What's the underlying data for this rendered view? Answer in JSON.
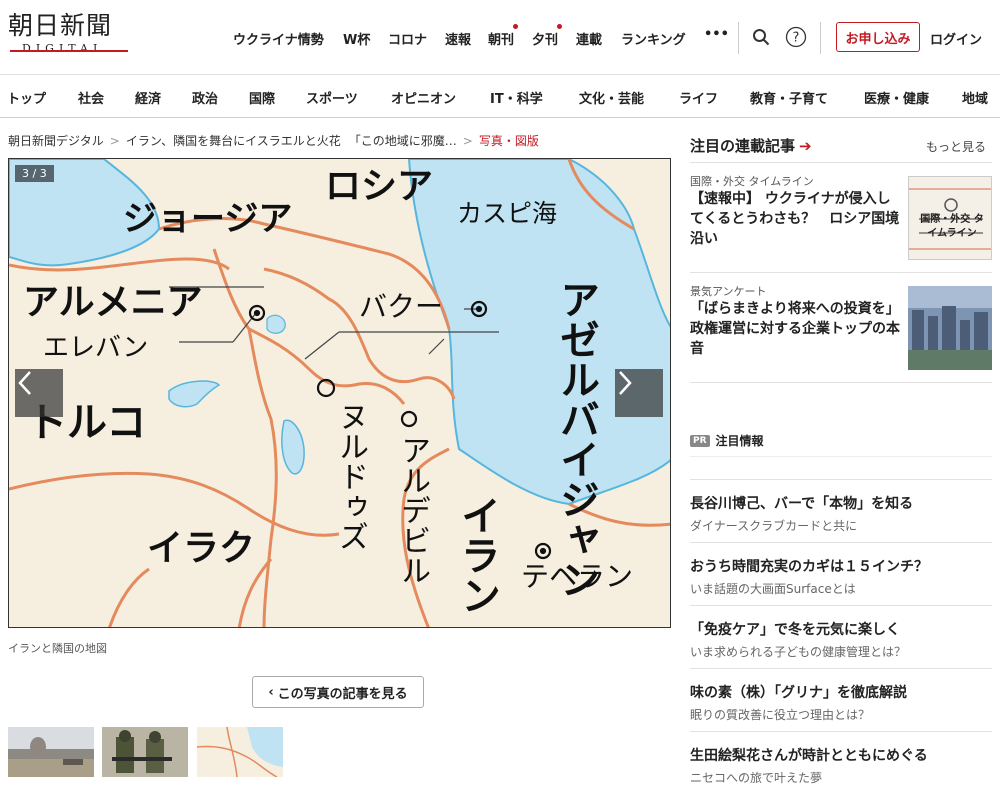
{
  "header": {
    "logo_ja": "朝日新聞",
    "logo_en": "DIGITAL",
    "nav": [
      "ウクライナ情勢",
      "W杯",
      "コロナ",
      "速報",
      "朝刊",
      "夕刊",
      "連載",
      "ランキング"
    ],
    "more": "•••",
    "apply_label": "お申し込み",
    "login_label": "ログイン",
    "accent_color": "#c41a22"
  },
  "categories": [
    "トップ",
    "社会",
    "経済",
    "政治",
    "国際",
    "スポーツ",
    "オピニオン",
    "IT・科学",
    "文化・芸能",
    "ライフ",
    "教育・子育て",
    "医療・健康",
    "地域"
  ],
  "breadcrumb": [
    "朝日新聞デジタル",
    "イラン、隣国を舞台にイスラエルと火花",
    "「この地域に邪魔…",
    "写真・図版"
  ],
  "viewer": {
    "counter": "3 / 3",
    "map_labels": {
      "russia": "ロシア",
      "georgia": "ジョージア",
      "caspian": "カスピ海",
      "armenia": "アルメニア",
      "yerevan": "エレバン",
      "baku": "バクー",
      "azerbaijan": "アゼルバイジャン",
      "turkey": "トルコ",
      "nordooz": "ヌルドゥズ",
      "ardabil": "アルデビル",
      "iran": "イラン",
      "iraq": "イラク",
      "tehran": "テヘラン"
    },
    "caption": "イランと隣国の地図",
    "see_article": "この写真の記事を見る"
  },
  "sidebar": {
    "heading": "注目の連載記事",
    "more": "もっと見る",
    "cards": [
      {
        "tag": "国際・外交 タイムライン",
        "title": "【速報中】 ウクライナが侵入してくるとうわさも？　ロシア国境沿い",
        "thumb_text": "国際・外交 タイムライン"
      },
      {
        "tag": "景気アンケート",
        "title": "「ばらまきより将来への投資を」　政権運営に対する企業トップの本音"
      }
    ],
    "pr_badge": "PR",
    "pr_label": "注目情報",
    "ads": [
      {
        "title": "長谷川博己、バーで「本物」を知る",
        "sub": "ダイナースクラブカードと共に"
      },
      {
        "title": "おうち時間充実のカギは１５インチ？",
        "sub": "いま話題の大画面Surfaceとは"
      },
      {
        "title": "「免疫ケア」で冬を元気に楽しく",
        "sub": "いま求められる子どもの健康管理とは？"
      },
      {
        "title": "味の素（株）「グリナ」を徹底解説",
        "sub": "眠りの質改善に役立つ理由とは？"
      },
      {
        "title": "生田絵梨花さんが時計とともにめぐる",
        "sub": "ニセコへの旅で叶えた夢"
      }
    ]
  }
}
